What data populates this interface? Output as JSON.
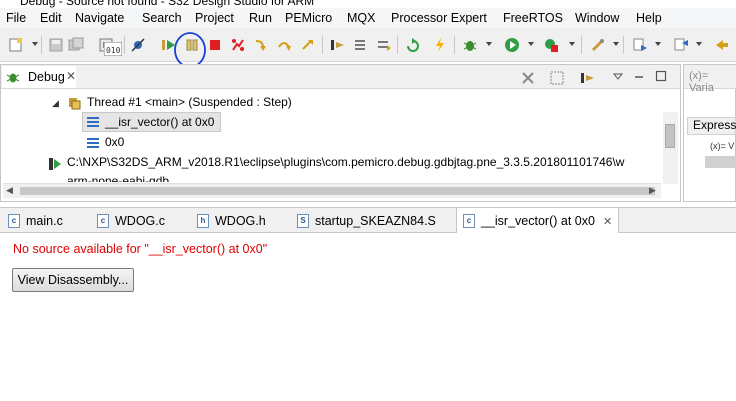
{
  "window": {
    "title_fragment": "Debug - Source not found - S32 Design Studio for ARM"
  },
  "menubar": {
    "items": [
      "File",
      "Edit",
      "Navigate",
      "Search",
      "Project",
      "Run",
      "PEMicro",
      "MQX",
      "Processor Expert",
      "FreeRTOS",
      "Window",
      "Help"
    ]
  },
  "toolbar": {
    "icons": [
      "new-icon",
      "save-icon",
      "save-all-icon",
      "print-icon",
      "disassembly-icon",
      "skip-breakpoints-icon",
      "resume-icon",
      "suspend-icon",
      "terminate-icon",
      "disconnect-icon",
      "step-into-icon",
      "step-over-icon",
      "step-return-icon",
      "instruction-stepping-icon",
      "drop-to-frame-icon",
      "use-step-filters-icon",
      "restart-icon",
      "lightning-icon",
      "debug-icon",
      "run-icon",
      "external-tools-icon",
      "build-icon",
      "next-annotation-icon",
      "prev-annotation-icon",
      "back-icon"
    ],
    "accent_annotation_color": "#1a3fd6"
  },
  "debug_view": {
    "tab_label": "Debug",
    "rows": [
      {
        "text": "Thread #1 <main> (Suspended : Step)"
      },
      {
        "text": "__isr_vector() at 0x0"
      },
      {
        "text": "0x0"
      },
      {
        "text": "C:\\NXP\\S32DS_ARM_v2018.R1\\eclipse\\plugins\\com.pemicro.debug.gdbjtag.pne_3.3.5.201801101746\\w"
      },
      {
        "text": "arm-none-eabi-gdb"
      }
    ]
  },
  "variables_view": {
    "tab_label": "(x)= Varia",
    "expressions_label": "Express",
    "sub_label": "(x)= V"
  },
  "editor_tabs": [
    {
      "label": "main.c",
      "icon": "c-file-icon"
    },
    {
      "label": "WDOG.c",
      "icon": "c-file-icon"
    },
    {
      "label": "WDOG.h",
      "icon": "h-file-icon"
    },
    {
      "label": "startup_SKEAZN84.S",
      "icon": "asm-file-icon"
    },
    {
      "label": "__isr_vector() at 0x0",
      "icon": "c-file-icon",
      "active": true
    }
  ],
  "editor": {
    "message": "No source available for \"__isr_vector() at 0x0\"",
    "button_label": "View Disassembly...",
    "message_color": "#e00000"
  }
}
